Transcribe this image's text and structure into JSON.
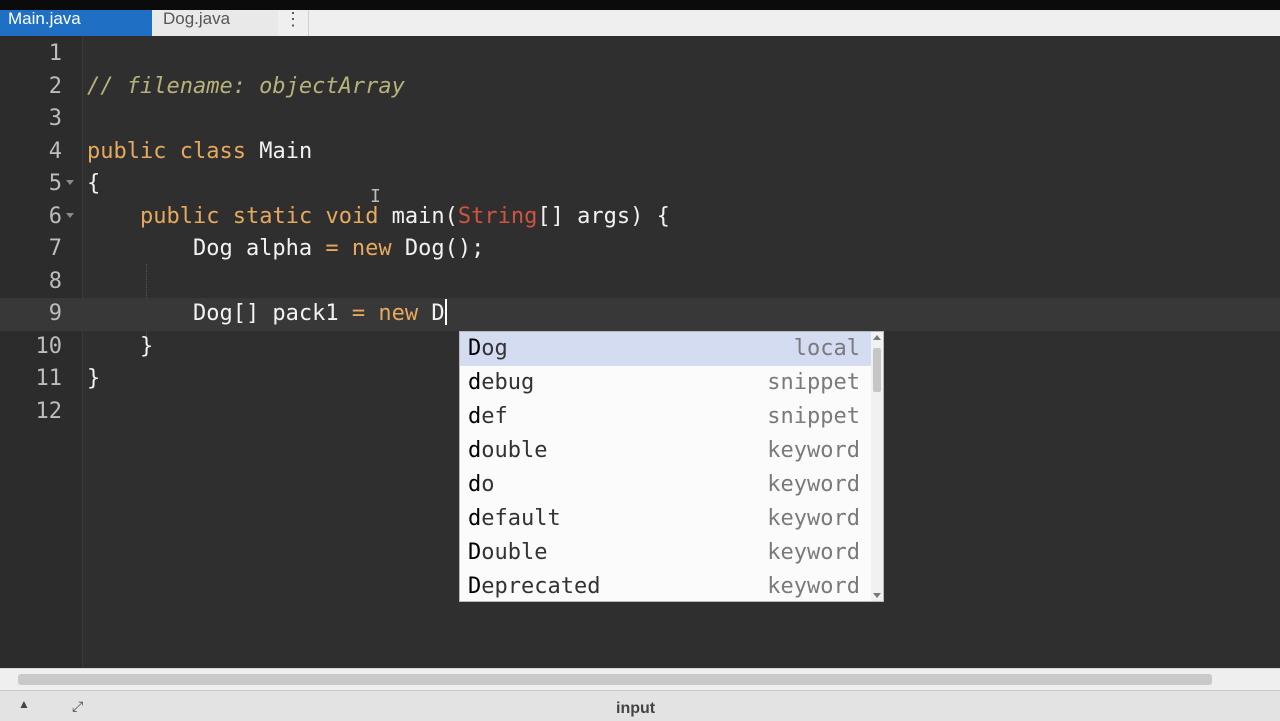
{
  "tabs": [
    {
      "label": "Main.java",
      "active": true
    },
    {
      "label": "Dog.java",
      "active": false
    }
  ],
  "tab_menu_icon": "kebab-menu-icon",
  "editor": {
    "line_numbers": [
      "1",
      "2",
      "3",
      "4",
      "5",
      "6",
      "7",
      "8",
      "9",
      "10",
      "11",
      "12"
    ],
    "current_line": 9,
    "lines": [
      "",
      "// filename: objectArray",
      "",
      "public class Main",
      "{",
      "    public static void main(String[] args) {",
      "        Dog alpha = new Dog();",
      "",
      "        Dog[] pack1 = new D",
      "    }",
      "}",
      ""
    ]
  },
  "autocomplete": {
    "typed_prefix": "D",
    "selected_index": 0,
    "items": [
      {
        "name": "Dog",
        "kind": "local"
      },
      {
        "name": "debug",
        "kind": "snippet"
      },
      {
        "name": "def",
        "kind": "snippet"
      },
      {
        "name": "double",
        "kind": "keyword"
      },
      {
        "name": "do",
        "kind": "keyword"
      },
      {
        "name": "default",
        "kind": "keyword"
      },
      {
        "name": "Double",
        "kind": "keyword"
      },
      {
        "name": "Deprecated",
        "kind": "keyword"
      }
    ]
  },
  "bottom_panel": {
    "label": "input"
  },
  "colors": {
    "active_tab": "#1f6fc4",
    "editor_bg": "#2f2f2f",
    "keyword": "#e6a95d",
    "comment": "#b7b27b",
    "type": "#d2533f",
    "selection": "#d4dcf2"
  }
}
